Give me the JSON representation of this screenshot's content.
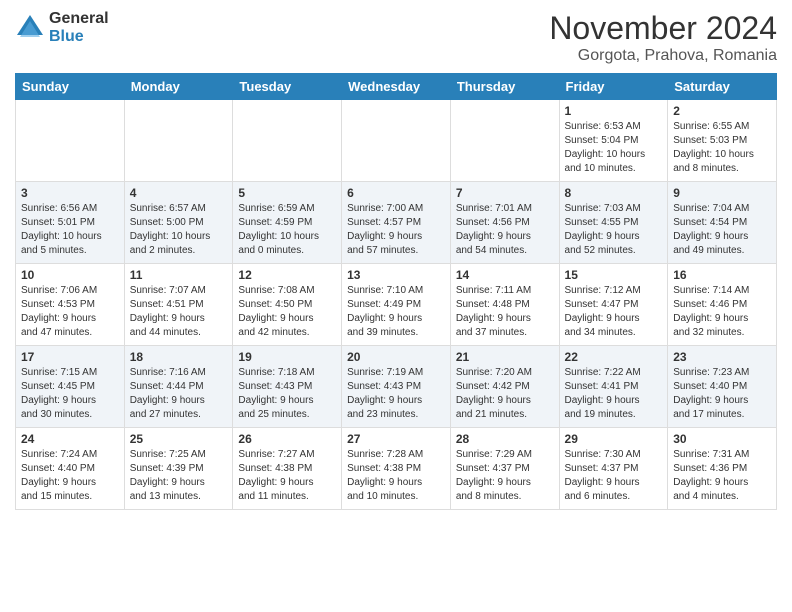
{
  "logo": {
    "general": "General",
    "blue": "Blue"
  },
  "title": "November 2024",
  "location": "Gorgota, Prahova, Romania",
  "weekdays": [
    "Sunday",
    "Monday",
    "Tuesday",
    "Wednesday",
    "Thursday",
    "Friday",
    "Saturday"
  ],
  "weeks": [
    [
      {
        "day": "",
        "info": ""
      },
      {
        "day": "",
        "info": ""
      },
      {
        "day": "",
        "info": ""
      },
      {
        "day": "",
        "info": ""
      },
      {
        "day": "",
        "info": ""
      },
      {
        "day": "1",
        "info": "Sunrise: 6:53 AM\nSunset: 5:04 PM\nDaylight: 10 hours\nand 10 minutes."
      },
      {
        "day": "2",
        "info": "Sunrise: 6:55 AM\nSunset: 5:03 PM\nDaylight: 10 hours\nand 8 minutes."
      }
    ],
    [
      {
        "day": "3",
        "info": "Sunrise: 6:56 AM\nSunset: 5:01 PM\nDaylight: 10 hours\nand 5 minutes."
      },
      {
        "day": "4",
        "info": "Sunrise: 6:57 AM\nSunset: 5:00 PM\nDaylight: 10 hours\nand 2 minutes."
      },
      {
        "day": "5",
        "info": "Sunrise: 6:59 AM\nSunset: 4:59 PM\nDaylight: 10 hours\nand 0 minutes."
      },
      {
        "day": "6",
        "info": "Sunrise: 7:00 AM\nSunset: 4:57 PM\nDaylight: 9 hours\nand 57 minutes."
      },
      {
        "day": "7",
        "info": "Sunrise: 7:01 AM\nSunset: 4:56 PM\nDaylight: 9 hours\nand 54 minutes."
      },
      {
        "day": "8",
        "info": "Sunrise: 7:03 AM\nSunset: 4:55 PM\nDaylight: 9 hours\nand 52 minutes."
      },
      {
        "day": "9",
        "info": "Sunrise: 7:04 AM\nSunset: 4:54 PM\nDaylight: 9 hours\nand 49 minutes."
      }
    ],
    [
      {
        "day": "10",
        "info": "Sunrise: 7:06 AM\nSunset: 4:53 PM\nDaylight: 9 hours\nand 47 minutes."
      },
      {
        "day": "11",
        "info": "Sunrise: 7:07 AM\nSunset: 4:51 PM\nDaylight: 9 hours\nand 44 minutes."
      },
      {
        "day": "12",
        "info": "Sunrise: 7:08 AM\nSunset: 4:50 PM\nDaylight: 9 hours\nand 42 minutes."
      },
      {
        "day": "13",
        "info": "Sunrise: 7:10 AM\nSunset: 4:49 PM\nDaylight: 9 hours\nand 39 minutes."
      },
      {
        "day": "14",
        "info": "Sunrise: 7:11 AM\nSunset: 4:48 PM\nDaylight: 9 hours\nand 37 minutes."
      },
      {
        "day": "15",
        "info": "Sunrise: 7:12 AM\nSunset: 4:47 PM\nDaylight: 9 hours\nand 34 minutes."
      },
      {
        "day": "16",
        "info": "Sunrise: 7:14 AM\nSunset: 4:46 PM\nDaylight: 9 hours\nand 32 minutes."
      }
    ],
    [
      {
        "day": "17",
        "info": "Sunrise: 7:15 AM\nSunset: 4:45 PM\nDaylight: 9 hours\nand 30 minutes."
      },
      {
        "day": "18",
        "info": "Sunrise: 7:16 AM\nSunset: 4:44 PM\nDaylight: 9 hours\nand 27 minutes."
      },
      {
        "day": "19",
        "info": "Sunrise: 7:18 AM\nSunset: 4:43 PM\nDaylight: 9 hours\nand 25 minutes."
      },
      {
        "day": "20",
        "info": "Sunrise: 7:19 AM\nSunset: 4:43 PM\nDaylight: 9 hours\nand 23 minutes."
      },
      {
        "day": "21",
        "info": "Sunrise: 7:20 AM\nSunset: 4:42 PM\nDaylight: 9 hours\nand 21 minutes."
      },
      {
        "day": "22",
        "info": "Sunrise: 7:22 AM\nSunset: 4:41 PM\nDaylight: 9 hours\nand 19 minutes."
      },
      {
        "day": "23",
        "info": "Sunrise: 7:23 AM\nSunset: 4:40 PM\nDaylight: 9 hours\nand 17 minutes."
      }
    ],
    [
      {
        "day": "24",
        "info": "Sunrise: 7:24 AM\nSunset: 4:40 PM\nDaylight: 9 hours\nand 15 minutes."
      },
      {
        "day": "25",
        "info": "Sunrise: 7:25 AM\nSunset: 4:39 PM\nDaylight: 9 hours\nand 13 minutes."
      },
      {
        "day": "26",
        "info": "Sunrise: 7:27 AM\nSunset: 4:38 PM\nDaylight: 9 hours\nand 11 minutes."
      },
      {
        "day": "27",
        "info": "Sunrise: 7:28 AM\nSunset: 4:38 PM\nDaylight: 9 hours\nand 10 minutes."
      },
      {
        "day": "28",
        "info": "Sunrise: 7:29 AM\nSunset: 4:37 PM\nDaylight: 9 hours\nand 8 minutes."
      },
      {
        "day": "29",
        "info": "Sunrise: 7:30 AM\nSunset: 4:37 PM\nDaylight: 9 hours\nand 6 minutes."
      },
      {
        "day": "30",
        "info": "Sunrise: 7:31 AM\nSunset: 4:36 PM\nDaylight: 9 hours\nand 4 minutes."
      }
    ]
  ]
}
